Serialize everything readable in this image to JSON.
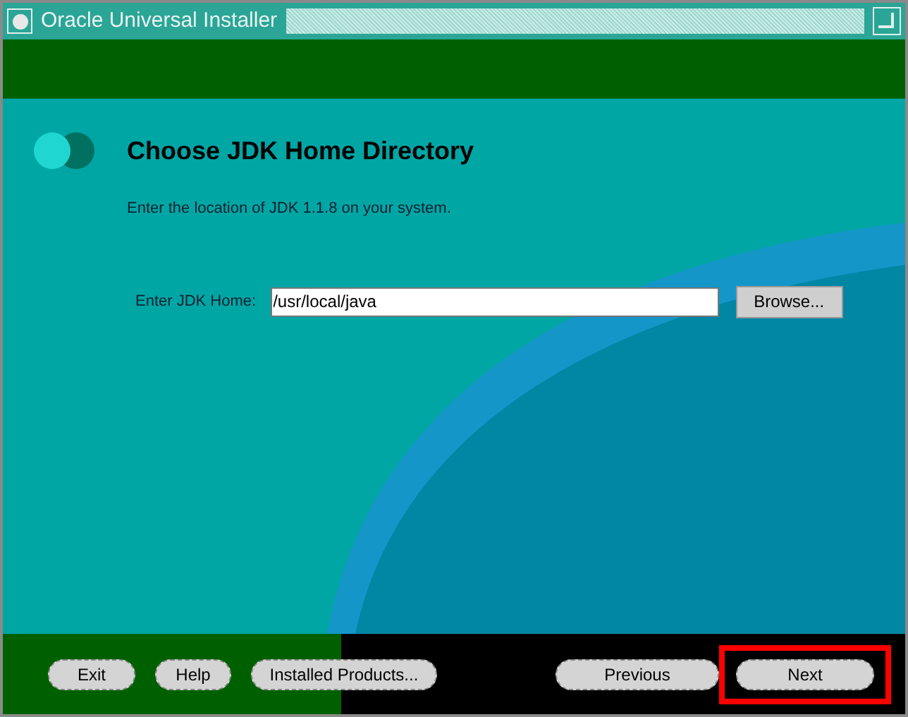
{
  "window": {
    "title": "Oracle Universal Installer"
  },
  "page": {
    "heading": "Choose JDK Home Directory",
    "description": "Enter the location of JDK 1.1.8 on your system.",
    "field": {
      "label": "Enter JDK Home:",
      "value": "/usr/local/java"
    },
    "browse_button": "Browse..."
  },
  "footer": {
    "left_buttons": [
      {
        "label": "Exit",
        "highlighted": false
      },
      {
        "label": "Help",
        "highlighted": false
      },
      {
        "label": "Installed Products...",
        "highlighted": false
      }
    ],
    "right_buttons": [
      {
        "label": "Previous",
        "highlighted": false
      },
      {
        "label": "Next",
        "highlighted": true
      }
    ]
  }
}
